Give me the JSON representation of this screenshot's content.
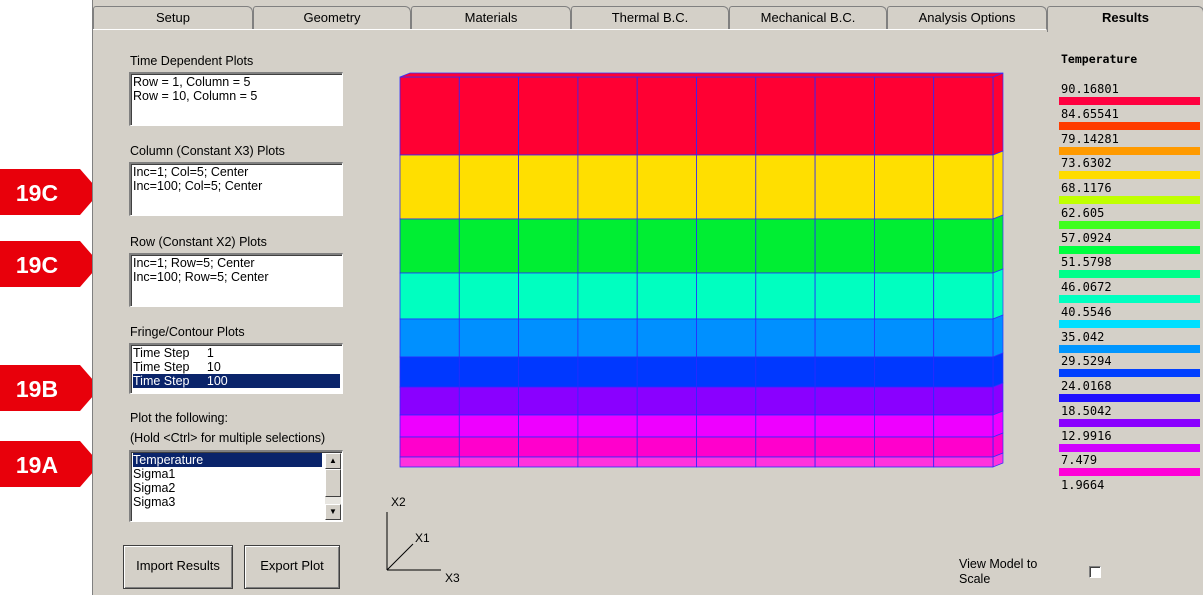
{
  "tabs": [
    {
      "label": "Setup"
    },
    {
      "label": "Geometry"
    },
    {
      "label": "Materials"
    },
    {
      "label": "Thermal B.C."
    },
    {
      "label": "Mechanical B.C."
    },
    {
      "label": "Analysis Options"
    },
    {
      "label": "Results",
      "active": true
    }
  ],
  "time_dependent": {
    "label": "Time Dependent Plots",
    "items": [
      "Row = 1, Column = 5",
      "Row = 10, Column = 5"
    ]
  },
  "column_plots": {
    "label": "Column (Constant X3) Plots",
    "items": [
      "Inc=1; Col=5; Center",
      "Inc=100; Col=5; Center"
    ]
  },
  "row_plots": {
    "label": "Row (Constant X2) Plots",
    "items": [
      "Inc=1; Row=5; Center",
      "Inc=100; Row=5; Center"
    ]
  },
  "fringe": {
    "label": "Fringe/Contour Plots",
    "items": [
      "Time Step     1",
      "Time Step     10",
      "Time Step     100"
    ],
    "selected_index": 2
  },
  "plot_following": {
    "label1": "Plot the following:",
    "label2": "(Hold <Ctrl> for multiple selections)",
    "items": [
      "Temperature",
      "Sigma1",
      "Sigma2",
      "Sigma3"
    ],
    "selected_index": 0
  },
  "buttons": {
    "import": "Import Results",
    "export": "Export Plot"
  },
  "axes": {
    "x2": "X2",
    "x1": "X1",
    "x3": "X3"
  },
  "view_scale": {
    "line1": "View Model to",
    "line2": "Scale"
  },
  "callouts": [
    "19C",
    "19C",
    "19B",
    "19A"
  ],
  "callout_color": "#e8000b",
  "legend": {
    "title": "Temperature",
    "values": [
      "90.16801",
      "84.65541",
      "79.14281",
      "73.6302",
      "68.1176",
      "62.605",
      "57.0924",
      "51.5798",
      "46.0672",
      "40.5546",
      "35.042",
      "29.5294",
      "24.0168",
      "18.5042",
      "12.9916",
      "7.479",
      "1.9664"
    ],
    "colors": [
      "#ff0040",
      "#ff3c00",
      "#ff9a00",
      "#ffdc00",
      "#c0ff00",
      "#40ff20",
      "#00ff40",
      "#00ff8a",
      "#00ffc0",
      "#00e0ff",
      "#0096ff",
      "#0040ff",
      "#2010ff",
      "#8a00ff",
      "#d000ff",
      "#ff00d8"
    ]
  },
  "plot_bands": [
    {
      "color": "#ff0033"
    },
    {
      "color": "#ffdf00"
    },
    {
      "color": "#00ee33"
    },
    {
      "color": "#00ffc0"
    },
    {
      "color": "#0090ff"
    },
    {
      "color": "#0038ff"
    },
    {
      "color": "#8a00ff"
    },
    {
      "color": "#ee00ff"
    },
    {
      "color": "#ff00cc"
    },
    {
      "color": "#ff33dd"
    }
  ]
}
